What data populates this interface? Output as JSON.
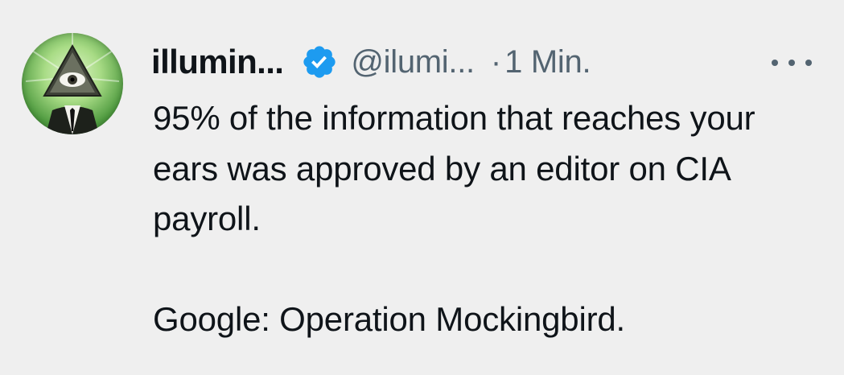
{
  "tweet": {
    "author": {
      "display_name": "illumin...",
      "handle": "@ilumi...",
      "verified": true,
      "avatar_icon": "illuminati-eye-pyramid-avatar"
    },
    "separator": "·",
    "timestamp": "1 Min.",
    "more_icon": "more-dots-icon",
    "text": {
      "paragraph_1": "95% of the information that reaches your ears was approved by an editor on CIA payroll.",
      "paragraph_2": "Google: Operation Mockingbird."
    },
    "colors": {
      "background": "#efefef",
      "text": "#0f1419",
      "secondary_text": "#536471",
      "verified_badge": "#1d9bf0"
    }
  }
}
